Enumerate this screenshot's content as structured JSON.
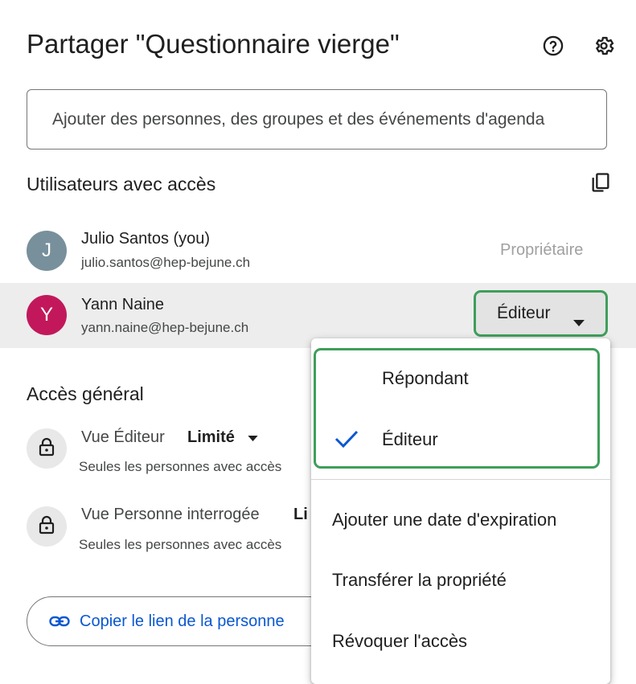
{
  "dialog": {
    "title": "Partager \"Questionnaire vierge\"",
    "help_icon": "help-circle-icon",
    "settings_icon": "gear-icon"
  },
  "search": {
    "placeholder": "Ajouter des personnes, des groupes et des événements d'agenda"
  },
  "users_section": {
    "title": "Utilisateurs avec accès",
    "copy_icon": "copy-emails-icon",
    "users": [
      {
        "initial": "J",
        "name": "Julio Santos (you)",
        "email": "julio.santos@hep-bejune.ch",
        "role": "Propriétaire",
        "avatar_color": "#78909c"
      },
      {
        "initial": "Y",
        "name": "Yann Naine",
        "email": "yann.naine@hep-bejune.ch",
        "role": "Éditeur",
        "avatar_color": "#c2185b"
      }
    ]
  },
  "general_access": {
    "title": "Accès général",
    "items": [
      {
        "label": "Vue Éditeur",
        "value": "Limité",
        "description": "Seules les personnes avec accès"
      },
      {
        "label": "Vue Personne interrogée",
        "value": "Li",
        "description": "Seules les personnes avec accès"
      }
    ]
  },
  "copy_link": {
    "label": "Copier le lien de la personne",
    "icon": "link-icon"
  },
  "role_menu": {
    "options": [
      {
        "label": "Répondant",
        "selected": false
      },
      {
        "label": "Éditeur",
        "selected": true
      }
    ],
    "actions": [
      "Ajouter une date d'expiration",
      "Transférer la propriété",
      "Révoquer l'accès"
    ]
  },
  "colors": {
    "accent": "#0b57d0",
    "highlight_border": "#3f9e5a",
    "selected_row": "#ededed"
  }
}
